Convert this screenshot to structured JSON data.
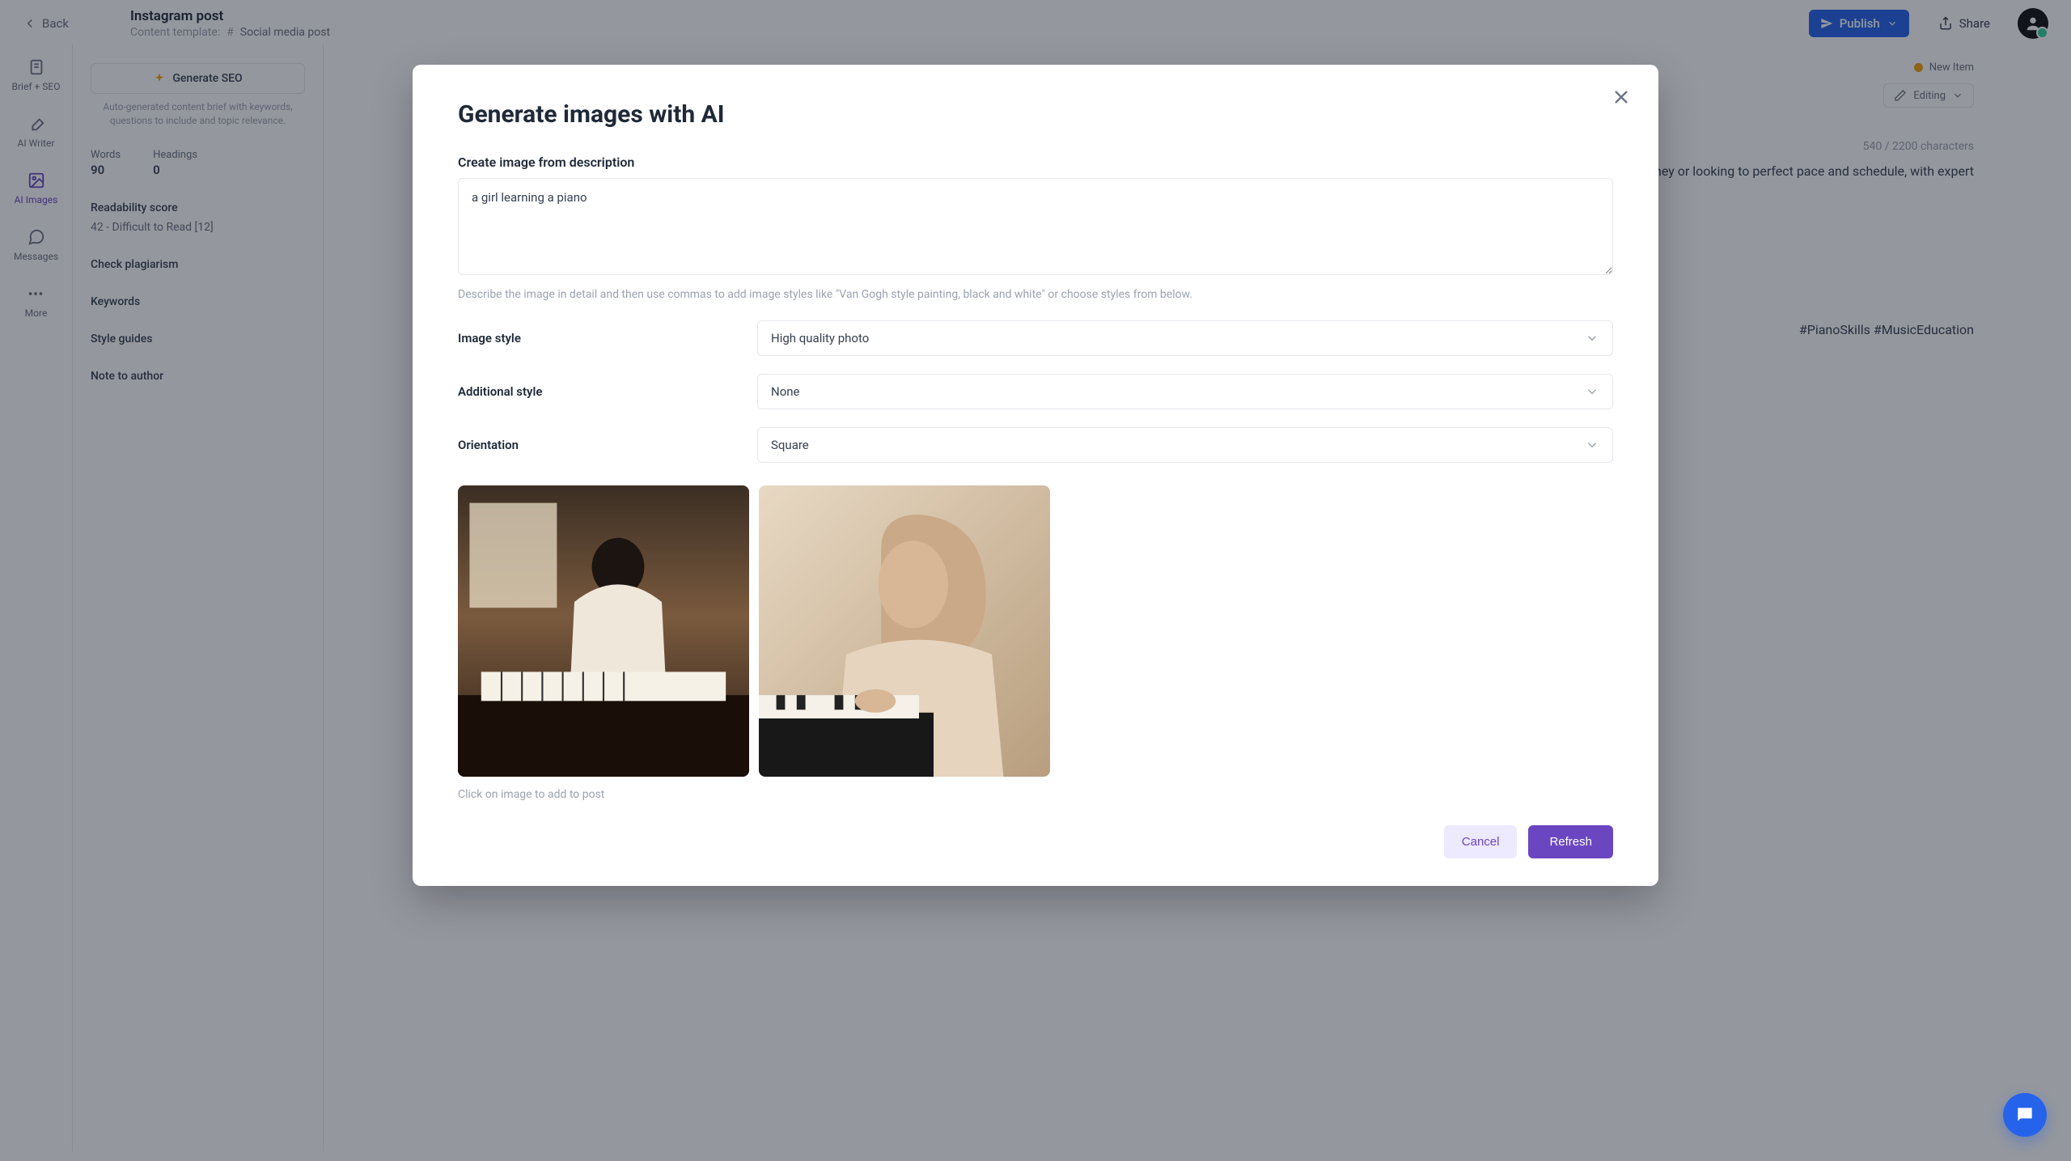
{
  "header": {
    "back": "Back",
    "title": "Instagram post",
    "template_label": "Content template:",
    "template_name": "Social media post",
    "publish": "Publish",
    "share": "Share"
  },
  "navrail": {
    "brief_seo": "Brief + SEO",
    "ai_writer": "AI Writer",
    "ai_images": "AI Images",
    "messages": "Messages",
    "more": "More"
  },
  "seo": {
    "button": "Generate SEO",
    "caption": "Auto-generated content brief with keywords, questions to include and topic relevance.",
    "words_label": "Words",
    "words_value": "90",
    "headings_label": "Headings",
    "headings_value": "0",
    "readability_label": "Readability score",
    "readability_value": "42 - Difficult to Read [12]",
    "check_plagiarism": "Check plagiarism",
    "keywords": "Keywords",
    "style_guides": "Style guides",
    "note_to_author": "Note to author"
  },
  "editor": {
    "new_item": "New Item",
    "editing": "Editing",
    "charcount": "540 / 2200 characters",
    "body_right": "musical journey or looking to perfect pace and schedule, with expert",
    "hashtags": "#PianoSkills #MusicEducation"
  },
  "modal": {
    "title": "Generate images with AI",
    "desc_label": "Create image from description",
    "desc_value": "a girl learning a piano",
    "desc_help": "Describe the image in detail and then use commas to add image styles like \"Van Gogh style painting, black and white\" or choose styles from below.",
    "image_style_label": "Image style",
    "image_style_value": "High quality photo",
    "additional_style_label": "Additional style",
    "additional_style_value": "None",
    "orientation_label": "Orientation",
    "orientation_value": "Square",
    "thumb_caption": "Click on image to add to post",
    "cancel": "Cancel",
    "refresh": "Refresh"
  }
}
